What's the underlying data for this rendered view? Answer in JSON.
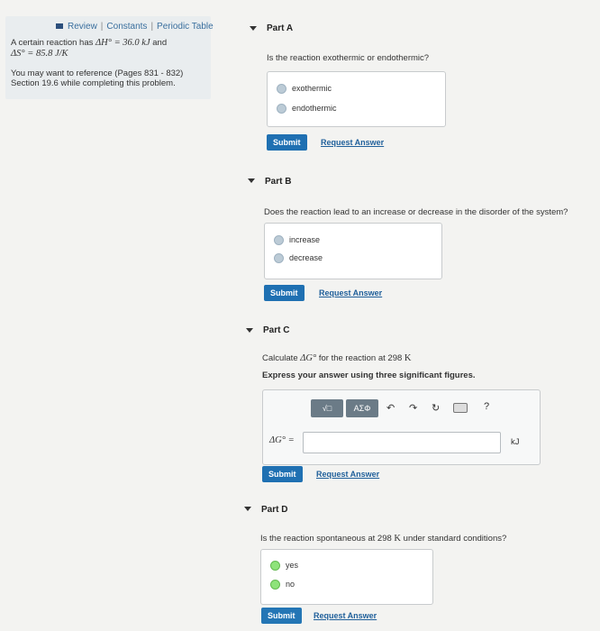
{
  "sidebar": {
    "links": [
      "Review",
      "Constants",
      "Periodic Table"
    ],
    "line1": "A certain reaction has",
    "dh": "ΔH° = 36.0 kJ",
    "and": "and",
    "ds": "ΔS° = 85.8 J/K",
    "note1": "You may want to reference (Pages 831 - 832)",
    "note2": "Section 19.6 while completing this problem."
  },
  "partA": {
    "title": "Part A",
    "question": "Is the reaction exothermic or endothermic?",
    "options": [
      "exothermic",
      "endothermic"
    ],
    "submit": "Submit",
    "request": "Request Answer"
  },
  "partB": {
    "title": "Part B",
    "question": "Does the reaction lead to an increase or decrease in the disorder of the system?",
    "options": [
      "increase",
      "decrease"
    ],
    "submit": "Submit",
    "request": "Request Answer"
  },
  "partC": {
    "title": "Part C",
    "q1a": "Calculate",
    "q1b": "ΔG°",
    "q1c": "for the reaction at 298",
    "q1d": "K",
    "q2": "Express your answer using three significant figures.",
    "toolbar": [
      "√□",
      "ΑΣΦ",
      "?"
    ],
    "answer_label": "ΔG° =",
    "answer_value": "",
    "unit": "kJ",
    "submit": "Submit",
    "request": "Request Answer"
  },
  "partD": {
    "title": "Part D",
    "q1": "Is the reaction spontaneous at 298",
    "q2": "K",
    "q3": "under standard conditions?",
    "options": [
      "yes",
      "no"
    ],
    "submit": "Submit",
    "request": "Request Answer"
  }
}
